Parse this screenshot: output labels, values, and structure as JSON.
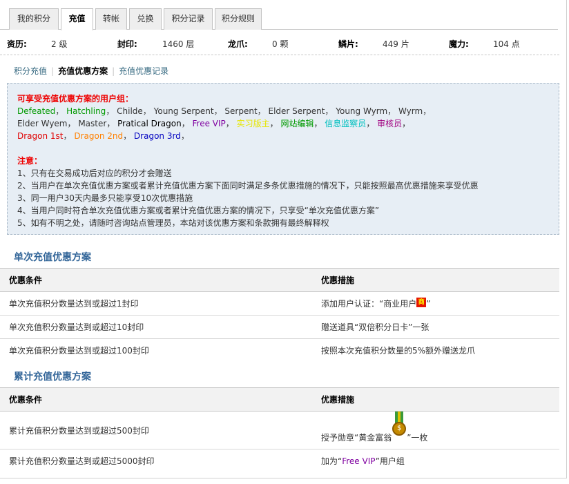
{
  "tabs": [
    "我的积分",
    "充值",
    "转帐",
    "兑换",
    "积分记录",
    "积分规则"
  ],
  "active_tab": "充值",
  "stats": [
    {
      "label": "资历:",
      "value": "2 级"
    },
    {
      "label": "封印:",
      "value": "1460 层"
    },
    {
      "label": "龙爪:",
      "value": "0 颗"
    },
    {
      "label": "鳞片:",
      "value": "449 片"
    },
    {
      "label": "魔力:",
      "value": "104 点"
    }
  ],
  "subnav": {
    "item1": "积分充值",
    "item2": "充值优惠方案",
    "item3": "充值优惠记录"
  },
  "notice": {
    "groups_title": "可享受充值优惠方案的用户组：",
    "groups": [
      {
        "name": "Defeated",
        "color": "#009900"
      },
      {
        "name": "Hatchling",
        "color": "#009900"
      },
      {
        "name": "Childe",
        "color": "#333333"
      },
      {
        "name": "Young Serpent",
        "color": "#333333"
      },
      {
        "name": "Serpent",
        "color": "#333333"
      },
      {
        "name": "Elder Serpent",
        "color": "#333333"
      },
      {
        "name": "Young Wyrm",
        "color": "#333333"
      },
      {
        "name": "Wyrm",
        "color": "#333333"
      },
      {
        "name": "Elder Wyem",
        "color": "#333333"
      },
      {
        "name": "Master",
        "color": "#333333"
      },
      {
        "name": "Pratical Dragon",
        "color": "#000000"
      },
      {
        "name": "Free VIP",
        "color": "#7f00a0"
      },
      {
        "name": "实习版主",
        "color": "#e6e600"
      },
      {
        "name": "网站编辑",
        "color": "#009900"
      },
      {
        "name": "信息监察员",
        "color": "#00c0c0"
      },
      {
        "name": "审核员",
        "color": "#a00080"
      },
      {
        "name": "Dragon 1st",
        "color": "#e00000"
      },
      {
        "name": "Dragon 2nd",
        "color": "#ff8000"
      },
      {
        "name": "Dragon 3rd",
        "color": "#0000c0"
      }
    ],
    "note_title": "注意：",
    "notes": [
      "1、只有在交易成功后对应的积分才会赠送",
      "2、当用户在单次充值优惠方案或者累计充值优惠方案下面同时满足多条优惠措施的情况下，只能按照最高优惠措施来享受优惠",
      "3、同一用户30天内最多只能享受10次优惠措施",
      "4、当用户同时符合单次充值优惠方案或者累计充值优惠方案的情况下，只享受“单次充值优惠方案”",
      "5、如有不明之处，请随时咨询站点管理员，本站对该优惠方案和条款拥有最终解释权"
    ]
  },
  "single": {
    "title": "单次充值优惠方案",
    "col1": "优惠条件",
    "col2": "优惠措施",
    "rows": [
      {
        "cond": "单次充值积分数量达到或超过1封印",
        "pre": "添加用户认证：“商业用户",
        "badge": "商",
        "post": "”"
      },
      {
        "cond": "单次充值积分数量达到或超过10封印",
        "pre": "赠送道具“双倍积分日卡”一张",
        "badge": "",
        "post": ""
      },
      {
        "cond": "单次充值积分数量达到或超过100封印",
        "pre": "按照本次充值积分数量的5%额外赠送龙爪",
        "badge": "",
        "post": ""
      }
    ]
  },
  "cumulative": {
    "title": "累计充值优惠方案",
    "col1": "优惠条件",
    "col2": "优惠措施",
    "rows": [
      {
        "cond": "累计充值积分数量达到或超过500封印",
        "pre": "授予勋章“黄金富翁",
        "post": "”一枚"
      },
      {
        "cond": "累计充值积分数量达到或超过5000封印",
        "pre": "加为“",
        "vip": "Free VIP",
        "post": "”用户组"
      }
    ]
  },
  "colors": {
    "accent": "#336699",
    "notice_bg": "#e7eef5",
    "header_bg": "#f2f2f2"
  }
}
